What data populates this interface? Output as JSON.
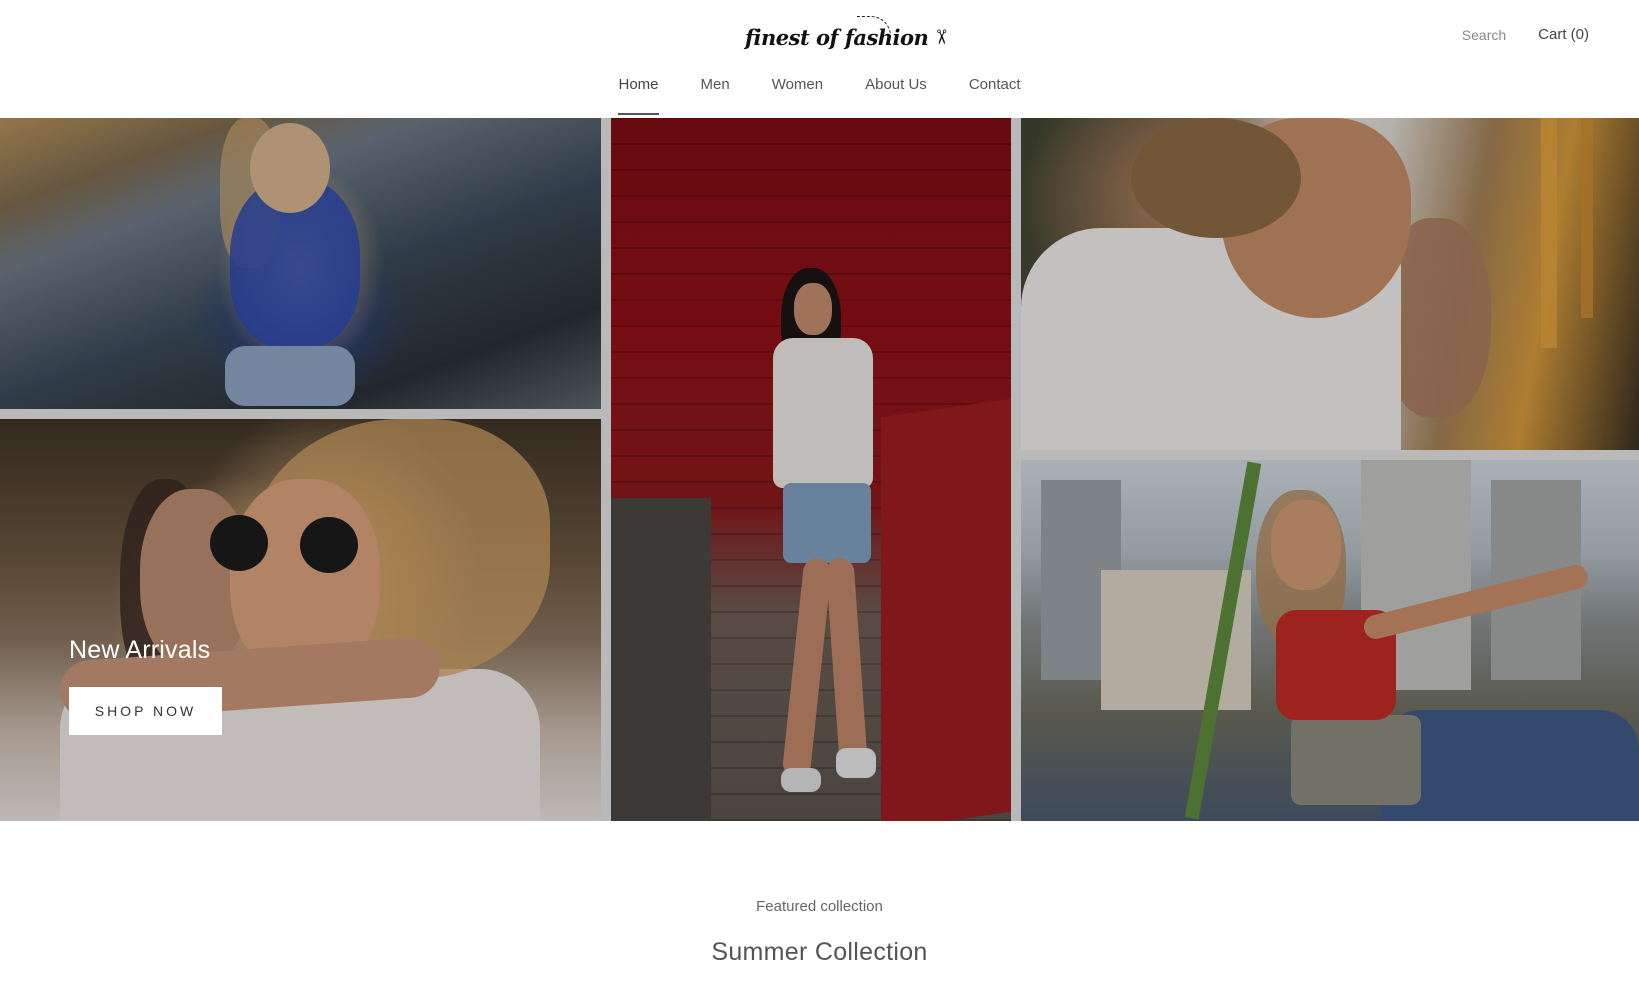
{
  "header": {
    "logo_text": "finest of fashion",
    "logo_icon": "scissors-icon",
    "search_label": "Search",
    "cart_label": "Cart (0)"
  },
  "nav": {
    "items": [
      {
        "label": "Home",
        "active": true
      },
      {
        "label": "Men",
        "active": false
      },
      {
        "label": "Women",
        "active": false
      },
      {
        "label": "About Us",
        "active": false
      },
      {
        "label": "Contact",
        "active": false
      }
    ]
  },
  "hero": {
    "title": "New Arrivals",
    "button_label": "SHOP NOW"
  },
  "featured": {
    "subtitle": "Featured collection",
    "title": "Summer Collection"
  }
}
